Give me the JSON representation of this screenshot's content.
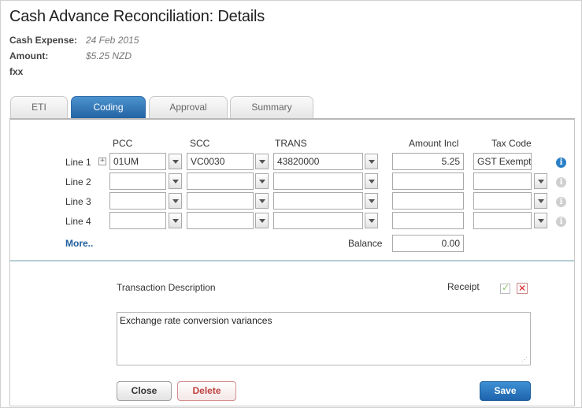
{
  "header": {
    "title": "Cash Advance Reconciliation: Details",
    "cash_expense_label": "Cash Expense:",
    "cash_expense_value": "24 Feb 2015",
    "amount_label": "Amount:",
    "amount_value": "$5.25 NZD",
    "user": "fxx"
  },
  "tabs": [
    {
      "label": "ETI"
    },
    {
      "label": "Coding"
    },
    {
      "label": "Approval"
    },
    {
      "label": "Summary"
    }
  ],
  "coding": {
    "columns": {
      "pcc": "PCC",
      "scc": "SCC",
      "trans": "TRANS",
      "amount": "Amount Incl",
      "tax": "Tax Code"
    },
    "lines": [
      {
        "label": "Line 1",
        "pcc": "01UM",
        "scc": "VC0030",
        "trans": "43820000",
        "amount": "5.25",
        "tax": "GST Exempt"
      },
      {
        "label": "Line 2",
        "pcc": "",
        "scc": "",
        "trans": "",
        "amount": "",
        "tax": ""
      },
      {
        "label": "Line 3",
        "pcc": "",
        "scc": "",
        "trans": "",
        "amount": "",
        "tax": ""
      },
      {
        "label": "Line 4",
        "pcc": "",
        "scc": "",
        "trans": "",
        "amount": "",
        "tax": ""
      }
    ],
    "more_label": "More..",
    "balance_label": "Balance",
    "balance_value": "0.00"
  },
  "description": {
    "label": "Transaction Description",
    "receipt_label": "Receipt",
    "text": "Exchange rate conversion variances"
  },
  "buttons": {
    "close": "Close",
    "delete": "Delete",
    "save": "Save"
  },
  "icons": {
    "plus": "plus-expand-icon",
    "info_active": "info-icon",
    "check": "checkmark-icon",
    "x": "x-close-icon"
  },
  "colors": {
    "accent": "#2463a3",
    "link": "#1f5f9c",
    "delete": "#c04040"
  }
}
